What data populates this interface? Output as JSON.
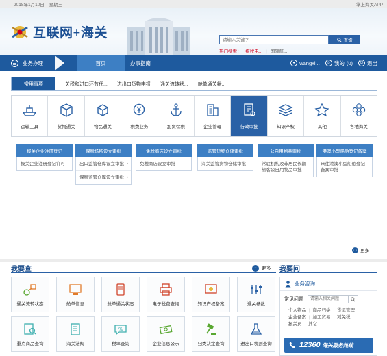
{
  "topbar": {
    "date": "2018年1月10日",
    "weekday": "星期三",
    "app": "掌上海关APP"
  },
  "header": {
    "site_title": "互联网+海关"
  },
  "search": {
    "placeholder": "请输入关键字",
    "button": "查询",
    "hot_label": "热门搜索：",
    "hot_items": [
      "报税电...",
      "国际航..."
    ]
  },
  "nav": {
    "business": "业务办理",
    "home": "首页",
    "guide": "办事指南",
    "user": "wangxi...",
    "mine": "我的",
    "count": "(0)",
    "logout": "退出"
  },
  "quick": {
    "label": "常用事项",
    "links": [
      "关税和进口环节代...",
      "进出口货物申报",
      "通关流转状...",
      "舱单通关状..."
    ]
  },
  "categories": [
    {
      "label": "运输工具",
      "icon": "ship-icon"
    },
    {
      "label": "货物通关",
      "icon": "box-icon"
    },
    {
      "label": "物品通关",
      "icon": "cube-icon"
    },
    {
      "label": "税费业务",
      "icon": "yen-coin-icon"
    },
    {
      "label": "加贸保税",
      "icon": "anchor-icon"
    },
    {
      "label": "企业管理",
      "icon": "building-icon"
    },
    {
      "label": "行政审批",
      "icon": "approval-doc-icon",
      "active": true
    },
    {
      "label": "知识产权",
      "icon": "layers-icon"
    },
    {
      "label": "其他",
      "icon": "pin-icon"
    },
    {
      "label": "各地海关",
      "icon": "flower-icon"
    }
  ],
  "approval": {
    "columns": [
      {
        "title": "报关企业注册登记",
        "rows": [
          "报关企业注册登记许可"
        ]
      },
      {
        "title": "保税场所设立审批",
        "rows": [
          "出口监管仓库设立审批",
          "保税监管仓库设立审批"
        ]
      },
      {
        "title": "免税商店设立审批",
        "rows": [
          "免税商店设立审批"
        ]
      },
      {
        "title": "监管货物仓储审批",
        "rows": [
          "海关监管货物仓储审批"
        ]
      },
      {
        "title": "公自用物品审批",
        "rows": [
          "常驻机构及非居民长期旅客公自用物品审批"
        ]
      },
      {
        "title": "港澳小型船舶登记备案",
        "rows": [
          "来往港澳小型船舶登记备案审批"
        ]
      }
    ],
    "more": "更多"
  },
  "woyaocha": {
    "title": "我要查",
    "more": "更多",
    "tiles": [
      {
        "label": "通关流转状态",
        "icon": "flow-icon"
      },
      {
        "label": "舱单信息",
        "icon": "computer-icon"
      },
      {
        "label": "舱单通关状态",
        "icon": "phone-status-icon"
      },
      {
        "label": "电子税费查询",
        "icon": "printer-icon"
      },
      {
        "label": "知识产权备案",
        "icon": "certificate-icon"
      },
      {
        "label": "通关参数",
        "icon": "sliders-icon"
      },
      {
        "label": "重点商品查询",
        "icon": "search-doc-icon"
      },
      {
        "label": "海关法规",
        "icon": "book-icon"
      },
      {
        "label": "税率查询",
        "icon": "chat-percent-icon"
      },
      {
        "label": "企业信息公示",
        "icon": "money-icon"
      },
      {
        "label": "归类决定查询",
        "icon": "gavel-icon"
      },
      {
        "label": "进出口税则查询",
        "icon": "flask-icon"
      }
    ]
  },
  "woyaowen": {
    "title": "我要问",
    "consult": "业务咨询",
    "faq_label": "常见问题",
    "faq_placeholder": "请输入相关问题",
    "links_row1": [
      "个人物品",
      "商品归类",
      "货运管理"
    ],
    "links_row2": [
      "企业备案",
      "加工贸易",
      "减免税"
    ],
    "links_row3": [
      "报关员",
      "其它"
    ],
    "hotline_num": "12360",
    "hotline_txt": "海关服务热线"
  },
  "colors": {
    "nav_blue": "#1e5a9e",
    "accent_blue": "#3d7fc4",
    "hot_red": "#d0021b"
  }
}
